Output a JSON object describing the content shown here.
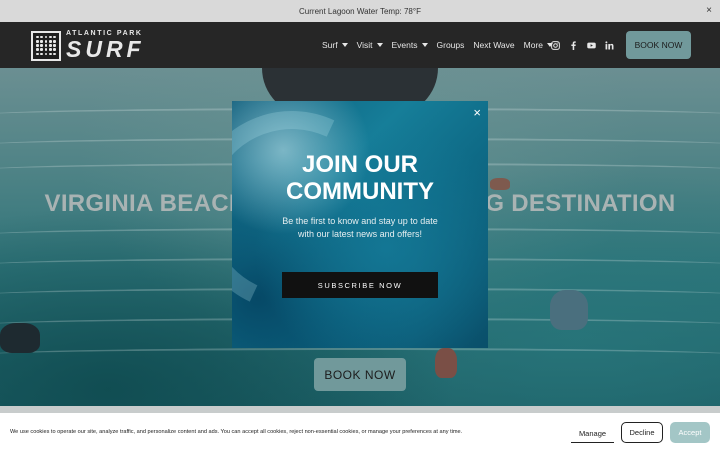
{
  "announcement": {
    "text": "Current Lagoon Water Temp: 78°F",
    "close_label": "×"
  },
  "header": {
    "logo_top": "ATLANTIC PARK",
    "logo_main": "SURF",
    "nav": [
      {
        "label": "Surf",
        "has_dropdown": true
      },
      {
        "label": "Visit",
        "has_dropdown": true
      },
      {
        "label": "Events",
        "has_dropdown": true
      },
      {
        "label": "Groups",
        "has_dropdown": false
      },
      {
        "label": "Next Wave",
        "has_dropdown": false
      },
      {
        "label": "More",
        "has_dropdown": true
      }
    ],
    "social_icons": [
      "instagram-icon",
      "facebook-icon",
      "youtube-icon",
      "linkedin-icon"
    ],
    "book_label": "BOOK NOW",
    "accent_color": "#71999b"
  },
  "hero": {
    "title": "VIRGINIA BEACH'S PREMIER SURFING DESTINATION",
    "book_label": "BOOK NOW"
  },
  "modal": {
    "close_label": "×",
    "title_line1": "JOIN OUR",
    "title_line2": "COMMUNITY",
    "body": "Be the first to know and stay up to date with our latest news and offers!",
    "button_label": "SUBSCRIBE NOW"
  },
  "cookie_banner": {
    "text": "We use cookies to operate our site, analyze traffic, and personalize content and ads. You can accept all cookies, reject non-essential cookies, or manage your preferences at any time.",
    "manage_label": "Manage",
    "decline_label": "Decline",
    "accept_label": "Accept",
    "accept_color": "#a3c6c6"
  }
}
